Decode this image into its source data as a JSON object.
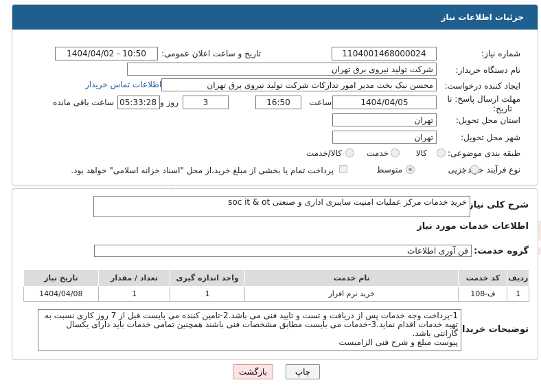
{
  "header": {
    "title": "جزئیات اطلاعات نیاز"
  },
  "fields": {
    "need_number_label": "شماره نیاز:",
    "need_number": "1104001468000024",
    "announce_label": "تاریخ و ساعت اعلان عمومی:",
    "announce_value": "1404/04/02 - 10:50",
    "buyer_org_label": "نام دستگاه خریدار:",
    "buyer_org": "شرکت تولید نیروی برق تهران",
    "creator_label": "ایجاد کننده درخواست:",
    "creator": "محسن نیک بخت مدیر امور تدارکات شرکت تولید نیروی برق تهران",
    "contact_link": "اطلاعات تماس خریدار",
    "deadline_label_1": "مهلت ارسال پاسخ: تا",
    "deadline_label_2": "تاریخ:",
    "deadline_date": "1404/04/05",
    "time_label": "ساعت",
    "deadline_time": "16:50",
    "days_value": "3",
    "days_label": "روز و",
    "remaining_time": "05:33:28",
    "remaining_label": "ساعت باقی مانده",
    "province_label": "استان محل تحویل:",
    "province": "تهران",
    "city_label": "شهر محل تحویل:",
    "city": "تهران",
    "category_label": "طبقه بندی موضوعی:",
    "cat_goods": "کالا",
    "cat_service": "خدمت",
    "cat_goods_service": "کالا/خدمت",
    "process_label": "نوع فرآیند خرید :",
    "proc_partial": "جزیی",
    "proc_medium": "متوسط",
    "payment_text": "پرداخت تمام یا بخشی از مبلغ خرید،از محل \"اسناد خزانه اسلامی\" خواهد بود."
  },
  "summary": {
    "label": "شرح کلی نیاز:",
    "value": "خرید خدمات مرکز عملیات امنیت سایبری اداری و صنعتی soc it & ot"
  },
  "services": {
    "section_title": "اطلاعات خدمات مورد نیاز",
    "group_label": "گروه خدمت:",
    "group_value": "فن آوری اطلاعات",
    "columns": [
      "ردیف",
      "کد خدمت",
      "نام خدمت",
      "واحد اندازه گیری",
      "تعداد / مقدار",
      "تاریخ نیاز"
    ],
    "rows": [
      [
        "1",
        "ف-108",
        "خرید نرم افزار",
        "1",
        "1",
        "1404/04/08"
      ]
    ]
  },
  "notes": {
    "label": "توضیحات خریدار:",
    "text": "1-پرداخت وجه خدمات پس از دریافت و تست و تایید فنی می باشد.2-تامین کننده می بایست قبل از 7 روز کاری نسبت به تهیه خدمات اقدام نماید.3-خدمات می بایست مطابق مشخصات فنی باشند همچنین تمامی خدمات باید دارای یکسال گارانتی باشد.\nپیوست مبلغ و شرح فنی الزامیست"
  },
  "buttons": {
    "print": "چاپ",
    "back": "بازگشت"
  },
  "watermark": "AriaTender.net",
  "colors": {
    "header": "#1f5f8f",
    "link": "#1f5f9f",
    "back_button": "#fde4e4"
  }
}
